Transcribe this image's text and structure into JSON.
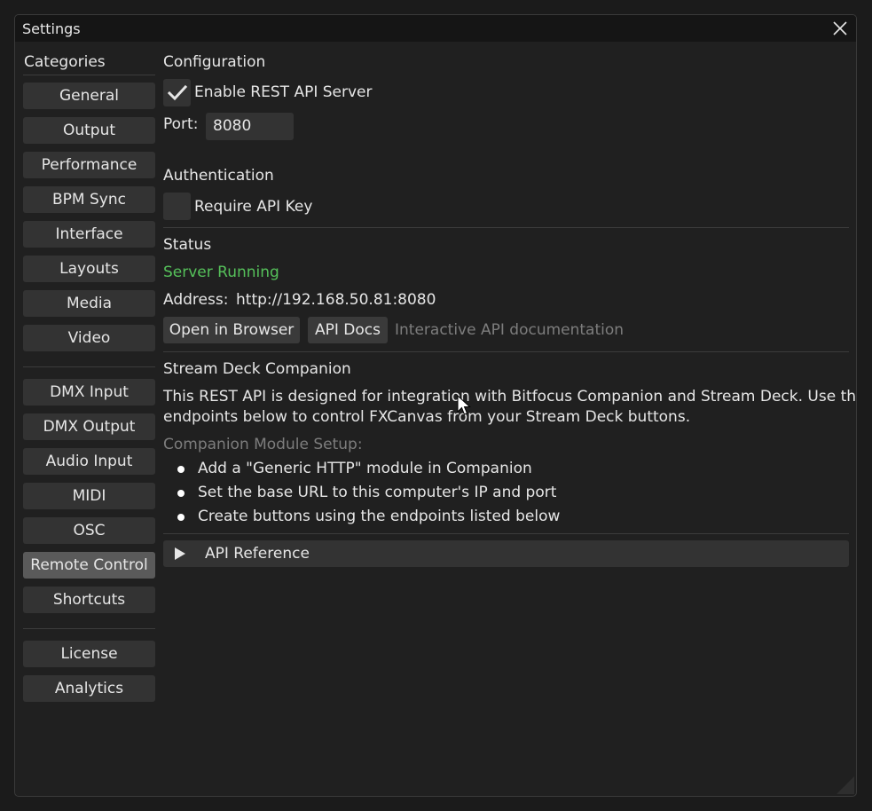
{
  "window": {
    "title": "Settings"
  },
  "sidebar": {
    "title": "Categories",
    "items": [
      {
        "label": "General"
      },
      {
        "label": "Output"
      },
      {
        "label": "Performance"
      },
      {
        "label": "BPM Sync"
      },
      {
        "label": "Interface"
      },
      {
        "label": "Layouts"
      },
      {
        "label": "Media"
      },
      {
        "label": "Video"
      },
      {
        "label": "DMX Input"
      },
      {
        "label": "DMX Output"
      },
      {
        "label": "Audio Input"
      },
      {
        "label": "MIDI"
      },
      {
        "label": "OSC"
      },
      {
        "label": "Remote Control",
        "active": true
      },
      {
        "label": "Shortcuts"
      },
      {
        "label": "License"
      },
      {
        "label": "Analytics"
      }
    ]
  },
  "configuration": {
    "heading": "Configuration",
    "enable_label": "Enable REST API Server",
    "enable_checked": true,
    "port_label": "Port:",
    "port_value": "8080"
  },
  "authentication": {
    "heading": "Authentication",
    "require_key_label": "Require API Key",
    "require_key_checked": false
  },
  "status": {
    "heading": "Status",
    "state": "Server Running",
    "state_color": "#55c05a",
    "address_label": "Address:",
    "address_value": "http://192.168.50.81:8080",
    "open_browser_label": "Open in Browser",
    "api_docs_label": "API Docs",
    "api_docs_hint": "Interactive API documentation"
  },
  "companion": {
    "heading": "Stream Deck Companion",
    "description_line1": "This REST API is designed for integration with Bitfocus Companion and Stream Deck. Use the",
    "description_line2": "endpoints below to control FXCanvas from your Stream Deck buttons.",
    "setup_label": "Companion Module Setup:",
    "steps": [
      "Add a \"Generic HTTP\" module in Companion",
      "Set the base URL to this computer's IP and port",
      "Create buttons using the endpoints listed below"
    ]
  },
  "api_reference": {
    "label": "API Reference",
    "expanded": false
  }
}
